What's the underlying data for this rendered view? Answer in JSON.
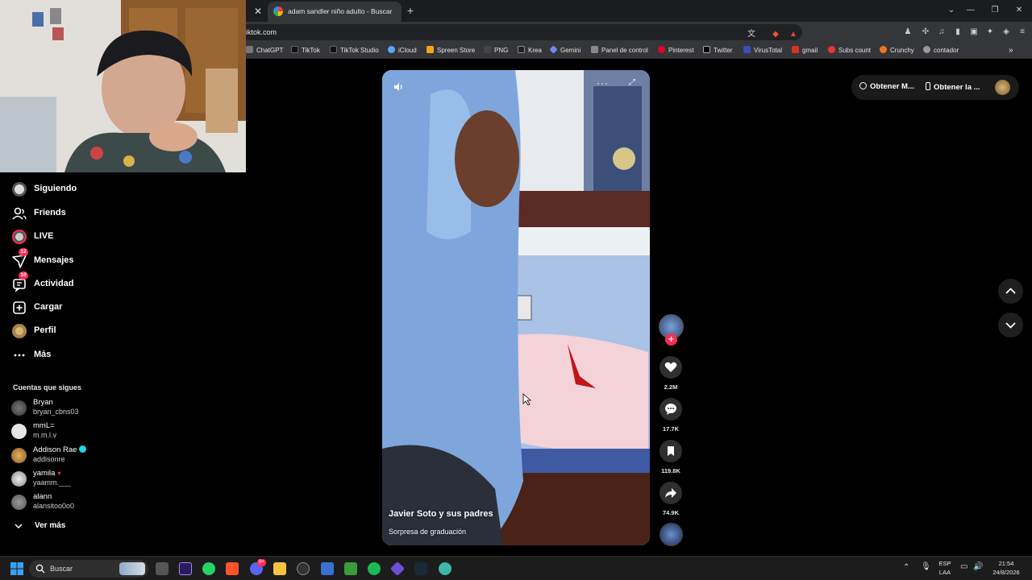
{
  "browser": {
    "tab_title": "adam sandler niño adulto - Buscar co",
    "url": "iktok.com",
    "bookmarks": [
      "ChatGPT",
      "TikTok",
      "TikTok Studio",
      "iCloud",
      "Spreen Store",
      "PNG",
      "Krea",
      "Gemini",
      "Panel de control",
      "Pinterest",
      "Twitter",
      "VirusTotal",
      "gmail",
      "Subs count",
      "Crunchy",
      "contador"
    ]
  },
  "sidebar": {
    "items": [
      {
        "label": "Siguiendo"
      },
      {
        "label": "Friends"
      },
      {
        "label": "LIVE"
      },
      {
        "label": "Mensajes",
        "badge": "12"
      },
      {
        "label": "Actividad",
        "badge": "10"
      },
      {
        "label": "Cargar"
      },
      {
        "label": "Perfil"
      },
      {
        "label": "Más"
      }
    ],
    "following_title": "Cuentas que sigues",
    "following": [
      {
        "name": "Bryan",
        "user": "bryan_cbns03"
      },
      {
        "name": "mmL=",
        "user": "m.m.l.v"
      },
      {
        "name": "Addison Rae",
        "user": "addisonre"
      },
      {
        "name": "yamila",
        "user": "yaamm.___"
      },
      {
        "name": "alann",
        "user": "alansitoo0o0"
      }
    ],
    "see_more": "Ver más"
  },
  "video": {
    "author": "Javier Soto y sus padres",
    "description": "Sorpresa de graduación"
  },
  "actions": {
    "likes": "2.2M",
    "comments": "17.7K",
    "saves": "119.8K",
    "shares": "74.9K"
  },
  "top_pills": {
    "get_coins": "Obtener M...",
    "get_app": "Obtener la ..."
  },
  "taskbar": {
    "search_placeholder": "Buscar",
    "lang": "ESP",
    "layout": "LAA",
    "time": "21:54",
    "date": "24/8/2026",
    "discord_badge": "9+"
  },
  "colors": {
    "accent": "#fe2c55",
    "verified": "#20d5ec"
  }
}
